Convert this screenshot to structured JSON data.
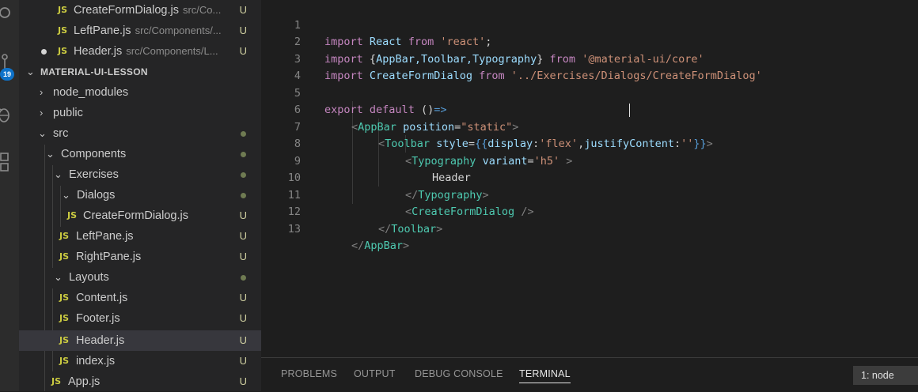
{
  "explorer": {
    "open_editors": [
      {
        "name": "CreateFormDialog.js",
        "path": "src/Co...",
        "status": "U"
      },
      {
        "name": "LeftPane.js",
        "path": "src/Components/...",
        "status": "U"
      },
      {
        "name": "Header.js",
        "path": "src/Components/L...",
        "status": "U"
      }
    ],
    "project_title": "MATERIAL-UI-LESSON",
    "tree": [
      {
        "label": "node_modules"
      },
      {
        "label": "public"
      },
      {
        "label": "src"
      },
      {
        "label": "Components"
      },
      {
        "label": "Exercises"
      },
      {
        "label": "Dialogs"
      },
      {
        "label": "CreateFormDialog.js",
        "status": "U"
      },
      {
        "label": "LeftPane.js",
        "status": "U"
      },
      {
        "label": "RightPane.js",
        "status": "U"
      },
      {
        "label": "Layouts"
      },
      {
        "label": "Content.js",
        "status": "U"
      },
      {
        "label": "Footer.js",
        "status": "U"
      },
      {
        "label": "Header.js",
        "status": "U"
      },
      {
        "label": "index.js",
        "status": "U"
      },
      {
        "label": "App.js",
        "status": "U"
      }
    ],
    "js_label": "JS"
  },
  "activity": {
    "badge": "19"
  },
  "editor": {
    "line_numbers": [
      "1",
      "2",
      "3",
      "4",
      "5",
      "6",
      "7",
      "8",
      "9",
      "10",
      "11",
      "12",
      "13"
    ],
    "code": {
      "l1": {
        "kw": "import",
        "id": "React",
        "from": "from",
        "str": "'react'",
        "end": ";"
      },
      "l2": {
        "kw": "import",
        "open": "{",
        "ids": "AppBar,Toolbar,Typography",
        "close": "}",
        "from": "from",
        "str": "'@material-ui/core'"
      },
      "l3": {
        "kw": "import",
        "id": "CreateFormDialog",
        "from": "from",
        "str": "'../Exercises/Dialogs/CreateFormDialog'"
      },
      "l5": {
        "kw": "export",
        "kw2": "default",
        "paren": "()",
        "arrow": "=>"
      },
      "l6": {
        "lt": "<",
        "tag": "AppBar",
        "attr": "position",
        "eq": "=",
        "str": "\"static\"",
        "gt": ">"
      },
      "l7": {
        "lt": "<",
        "tag": "Toolbar",
        "attr": "style",
        "eq": "=",
        "open": "{{",
        "k1": "display",
        "c1": ":",
        "v1": "'flex'",
        "comma": ",",
        "k2": "justifyContent",
        "c2": ":",
        "v2": "''",
        "close": "}}",
        "gt": ">"
      },
      "l8": {
        "lt": "<",
        "tag": "Typography",
        "attr": "variant",
        "eq": "=",
        "str": "'h5'",
        "gt": ">"
      },
      "l9": {
        "text": "Header"
      },
      "l10": {
        "lt": "</",
        "tag": "Typography",
        "gt": ">"
      },
      "l11": {
        "lt": "<",
        "tag": "CreateFormDialog",
        "gt": "/>"
      },
      "l12": {
        "lt": "</",
        "tag": "Toolbar",
        "gt": ">"
      },
      "l13": {
        "lt": "</",
        "tag": "AppBar",
        "gt": ">"
      }
    }
  },
  "panel": {
    "tabs": [
      "PROBLEMS",
      "OUTPUT",
      "DEBUG CONSOLE",
      "TERMINAL"
    ],
    "active_tab": "TERMINAL",
    "terminal_select": "1: node"
  },
  "colors": {
    "background": "#1e1e1e",
    "sidebar": "#252526",
    "selected": "#37373d",
    "badge": "#0e72c9"
  }
}
